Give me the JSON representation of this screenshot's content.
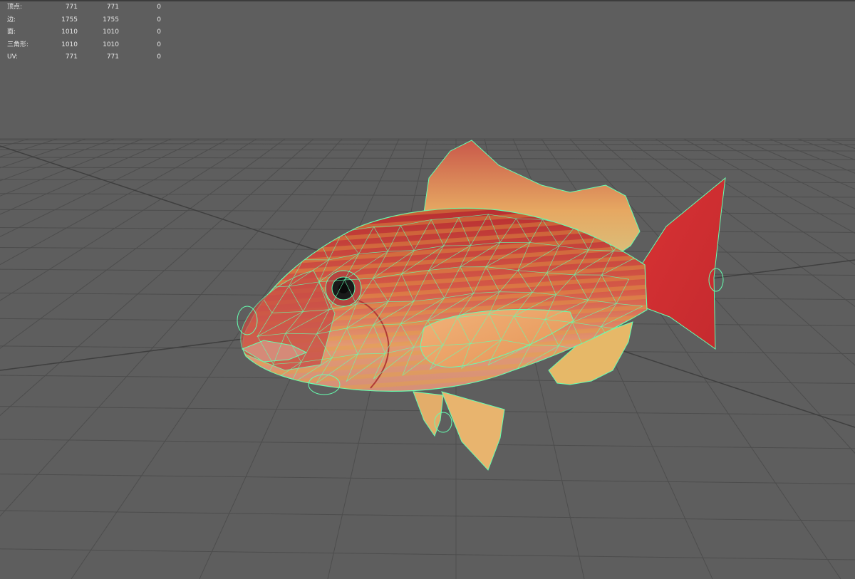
{
  "heads_up_display": {
    "rows": [
      {
        "label": "顶点:",
        "values": [
          "771",
          "771",
          "0"
        ]
      },
      {
        "label": "边:",
        "values": [
          "1755",
          "1755",
          "0"
        ]
      },
      {
        "label": "面:",
        "values": [
          "1010",
          "1010",
          "0"
        ]
      },
      {
        "label": "三角形:",
        "values": [
          "1010",
          "1010",
          "0"
        ]
      },
      {
        "label": "UV:",
        "values": [
          "771",
          "771",
          "0"
        ]
      }
    ]
  },
  "colors": {
    "viewport_background": "#5e5e5e",
    "grid_line": "#4a4a4a",
    "wireframe": "#66ffb0",
    "fish_body": "#c8403a",
    "fish_belly": "#e6a070",
    "fish_fin": "#e3b26a",
    "fish_tail": "#d23a36"
  },
  "model": {
    "name": "fish-mesh"
  }
}
